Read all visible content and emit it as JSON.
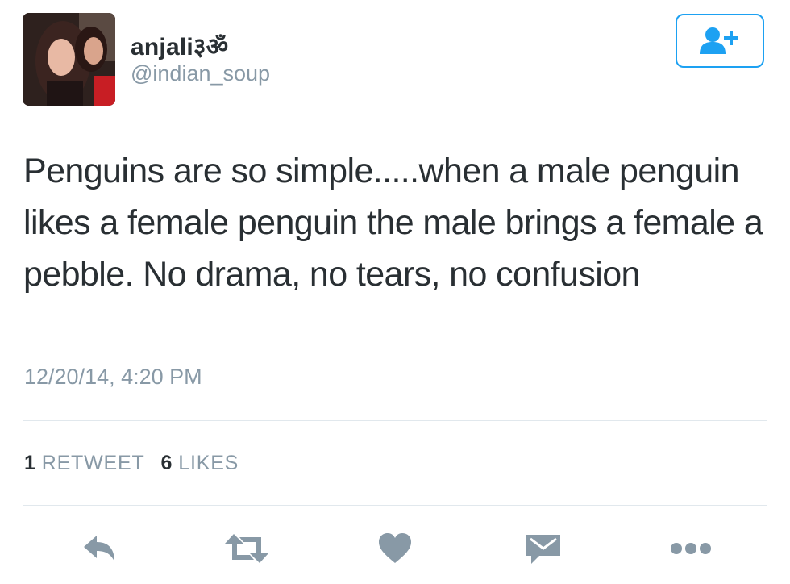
{
  "header": {
    "display_name": "anjali३ॐ",
    "username": "@indian_soup",
    "follow_icon": "add-user-icon"
  },
  "tweet": {
    "text": "Penguins are so simple.....when a male penguin likes a female penguin the male brings a female a pebble. No drama, no tears, no confusion",
    "timestamp": "12/20/14, 4:20 PM"
  },
  "stats": {
    "retweets_count": "1",
    "retweets_label": "RETWEET",
    "likes_count": "6",
    "likes_label": "LIKES"
  },
  "actions": [
    "reply-icon",
    "retweet-icon",
    "like-icon",
    "direct-message-icon",
    "more-icon"
  ],
  "colors": {
    "accent": "#1da1f2",
    "icon_gray": "#8899a6",
    "text": "#292f33",
    "divider": "#e1e8ed"
  }
}
